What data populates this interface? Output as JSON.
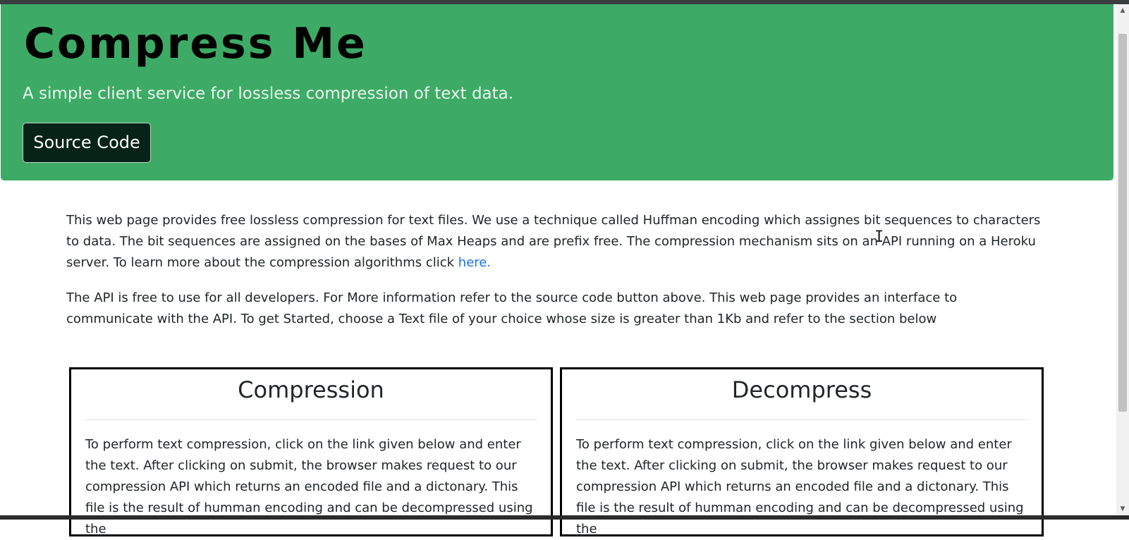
{
  "hero": {
    "title": "Compress Me",
    "subtitle": "A simple client service for lossless compression of text data.",
    "source_button_label": "Source Code"
  },
  "intro": {
    "paragraph1_text": "This web page provides free lossless compression for text files. We use a technique called Huffman encoding which assignes bit sequences to characters to data. The bit sequences are assigned on the bases of Max Heaps and are prefix free. The compression mechanism sits on an API running on a Heroku server. To learn more about the compression algorithms click ",
    "paragraph1_link": "here.",
    "paragraph2_text": "The API is free to use for all developers. For More information refer to the source code button above. This web page provides an interface to communicate with the API. To get Started, choose a Text file of your choice whose size is greater than 1Kb and refer to the section below"
  },
  "cards": {
    "compression": {
      "title": "Compression",
      "text": "To perform text compression, click on the link given below and enter the text. After clicking on submit, the browser makes request to our compression API which returns an encoded file and a dictonary. This file is the result of humman encoding and can be decompressed using the"
    },
    "decompress": {
      "title": "Decompress",
      "text": "To perform text compression, click on the link given below and enter the text. After clicking on submit, the browser makes request to our compression API which returns an encoded file and a dictonary. This file is the result of humman encoding and can be decompressed using the"
    }
  },
  "colors": {
    "hero_background": "#3dab65",
    "button_background": "#072318",
    "link": "#1a73e8"
  },
  "icons": {
    "scroll_up": "scroll-up-arrow-icon",
    "scroll_down": "scroll-down-arrow-icon",
    "cursor": "text-cursor-icon"
  }
}
